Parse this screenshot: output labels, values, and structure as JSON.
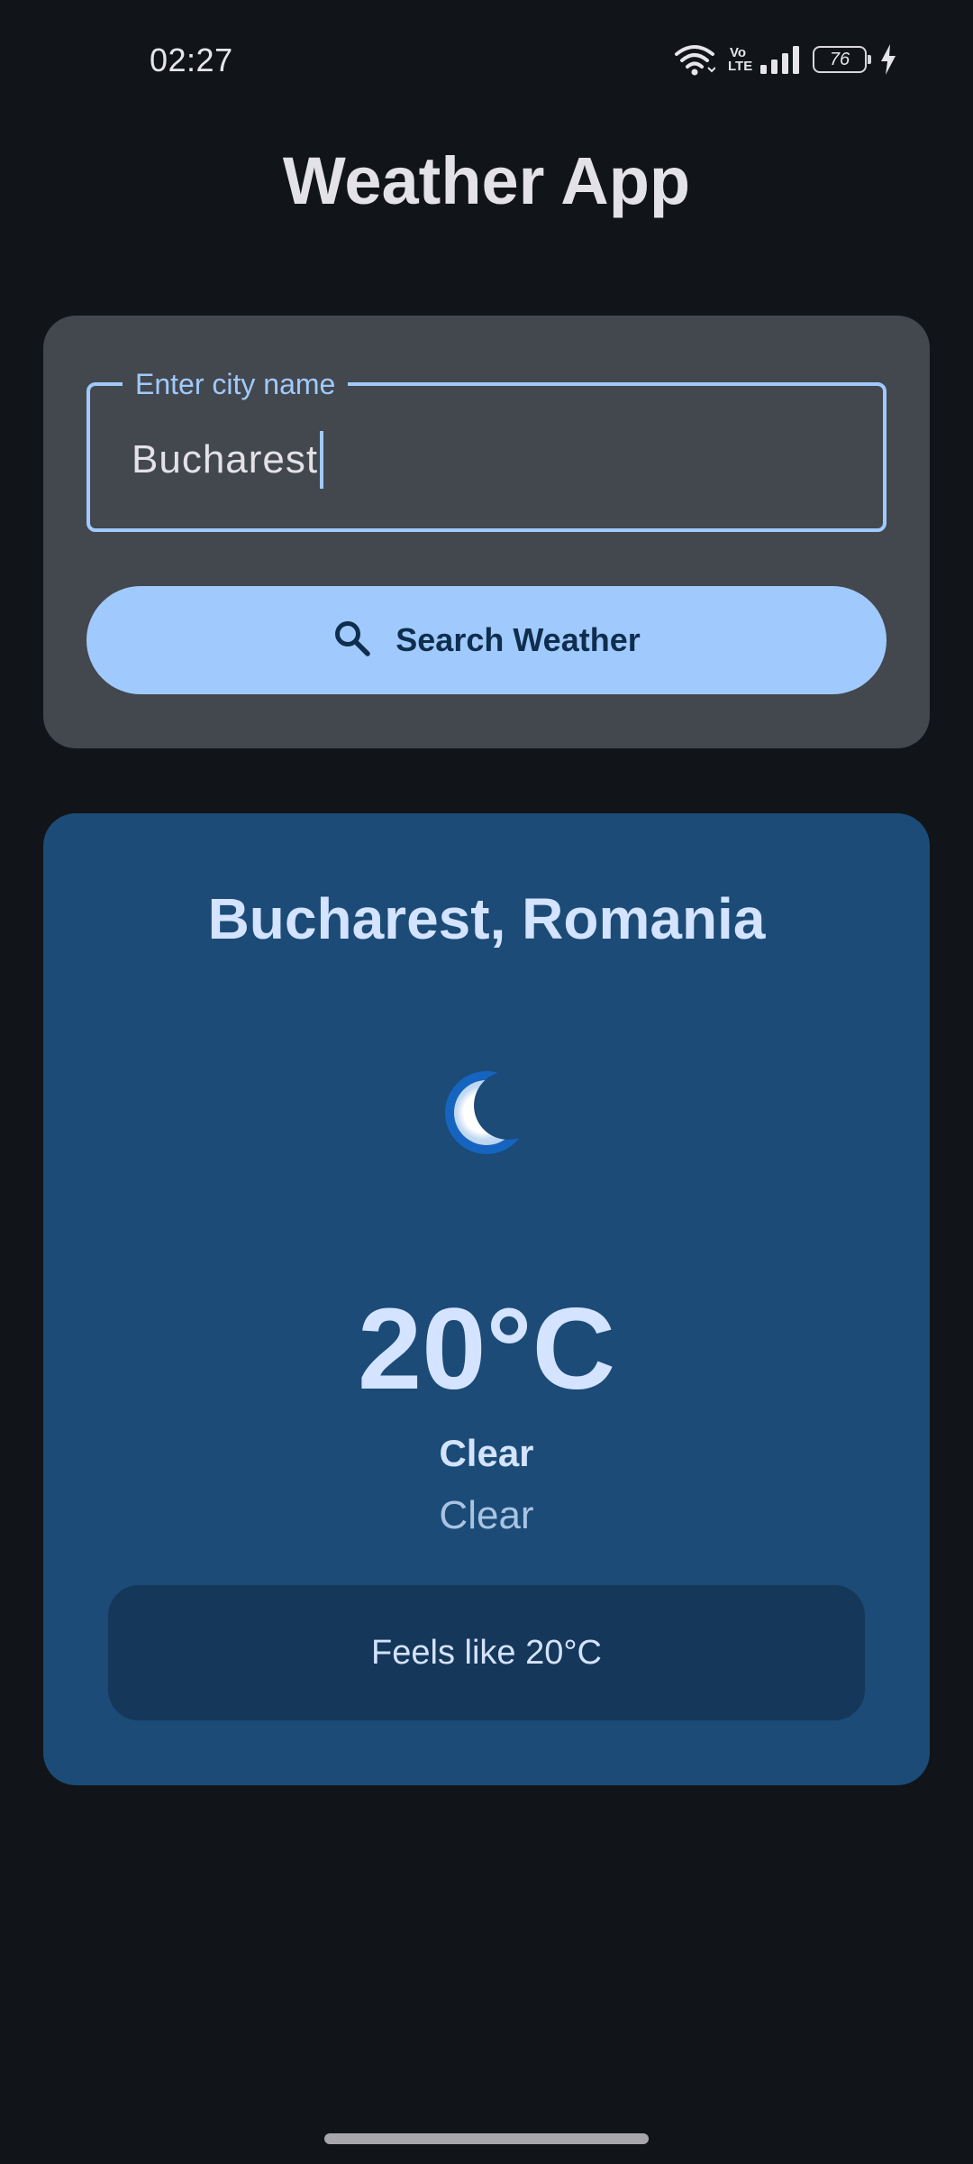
{
  "status_bar": {
    "time": "02:27",
    "battery_level": "76",
    "network_label_top": "Vo",
    "network_label_bottom": "LTE",
    "icons": [
      "wifi-icon",
      "volte-icon",
      "signal-icon",
      "battery-icon",
      "charging-icon"
    ]
  },
  "app": {
    "title": "Weather App"
  },
  "search": {
    "label": "Enter city name",
    "value": "Bucharest",
    "button_label": "Search Weather",
    "button_icon": "search-icon"
  },
  "weather": {
    "location": "Bucharest, Romania",
    "icon": "moon-icon",
    "temperature": "20°C",
    "condition_main": "Clear",
    "condition_description": "Clear",
    "feels_like": "Feels like 20°C"
  },
  "colors": {
    "background": "#111418",
    "search_card": "#43474e",
    "accent": "#a0cafd",
    "weather_card": "#1b4b76",
    "feels_box": "#15375a"
  }
}
